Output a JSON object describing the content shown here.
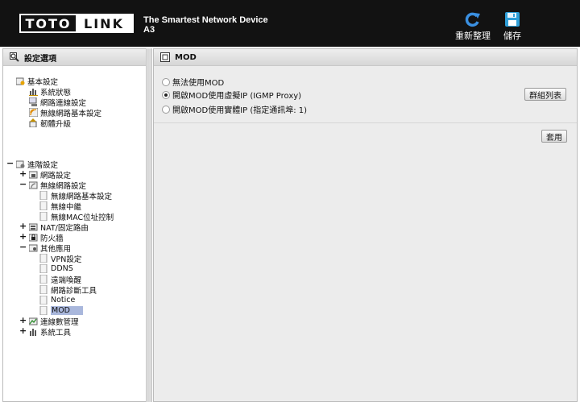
{
  "header": {
    "logo_left": "TOTO",
    "logo_right": "LINK",
    "tagline": "The Smartest Network Device",
    "model": "A3",
    "refresh_label": "重新整理",
    "save_label": "儲存",
    "colors": {
      "bar": "#121212",
      "refresh_icon": "#3a8fe0",
      "save_icon": "#2f9fd8"
    }
  },
  "sidebar": {
    "title": "設定選項",
    "basic": {
      "label": "基本設定",
      "items": [
        "系統狀態",
        "網路連線設定",
        "無線網路基本設定",
        "韌體升級"
      ]
    },
    "advanced": {
      "label": "進階設定",
      "toggle": "−",
      "groups": [
        {
          "label": "網路設定",
          "toggle": "+"
        },
        {
          "label": "無線網路設定",
          "toggle": "−",
          "children": [
            "無線網路基本設定",
            "無線中繼",
            "無線MAC位址控制"
          ]
        },
        {
          "label": "NAT/固定路由",
          "toggle": "+"
        },
        {
          "label": "防火牆",
          "toggle": "+"
        },
        {
          "label": "其他應用",
          "toggle": "−",
          "children": [
            "VPN設定",
            "DDNS",
            "遠端喚醒",
            "網路診斷工具",
            "Notice",
            "MOD"
          ]
        },
        {
          "label": "連線數管理",
          "toggle": "+"
        },
        {
          "label": "系統工具",
          "toggle": "+"
        }
      ]
    },
    "selected": "MOD",
    "selected_color": "#a9b7dc"
  },
  "main": {
    "title": "MOD",
    "options": [
      {
        "label": "無法使用MOD",
        "checked": false
      },
      {
        "label": "開啟MOD使用虛擬IP (IGMP Proxy)",
        "checked": true
      },
      {
        "label": "開啟MOD使用實體IP (指定通訊埠: 1)",
        "checked": false
      }
    ],
    "group_list_button": "群組列表",
    "apply_button": "套用",
    "background": "#ececec"
  }
}
